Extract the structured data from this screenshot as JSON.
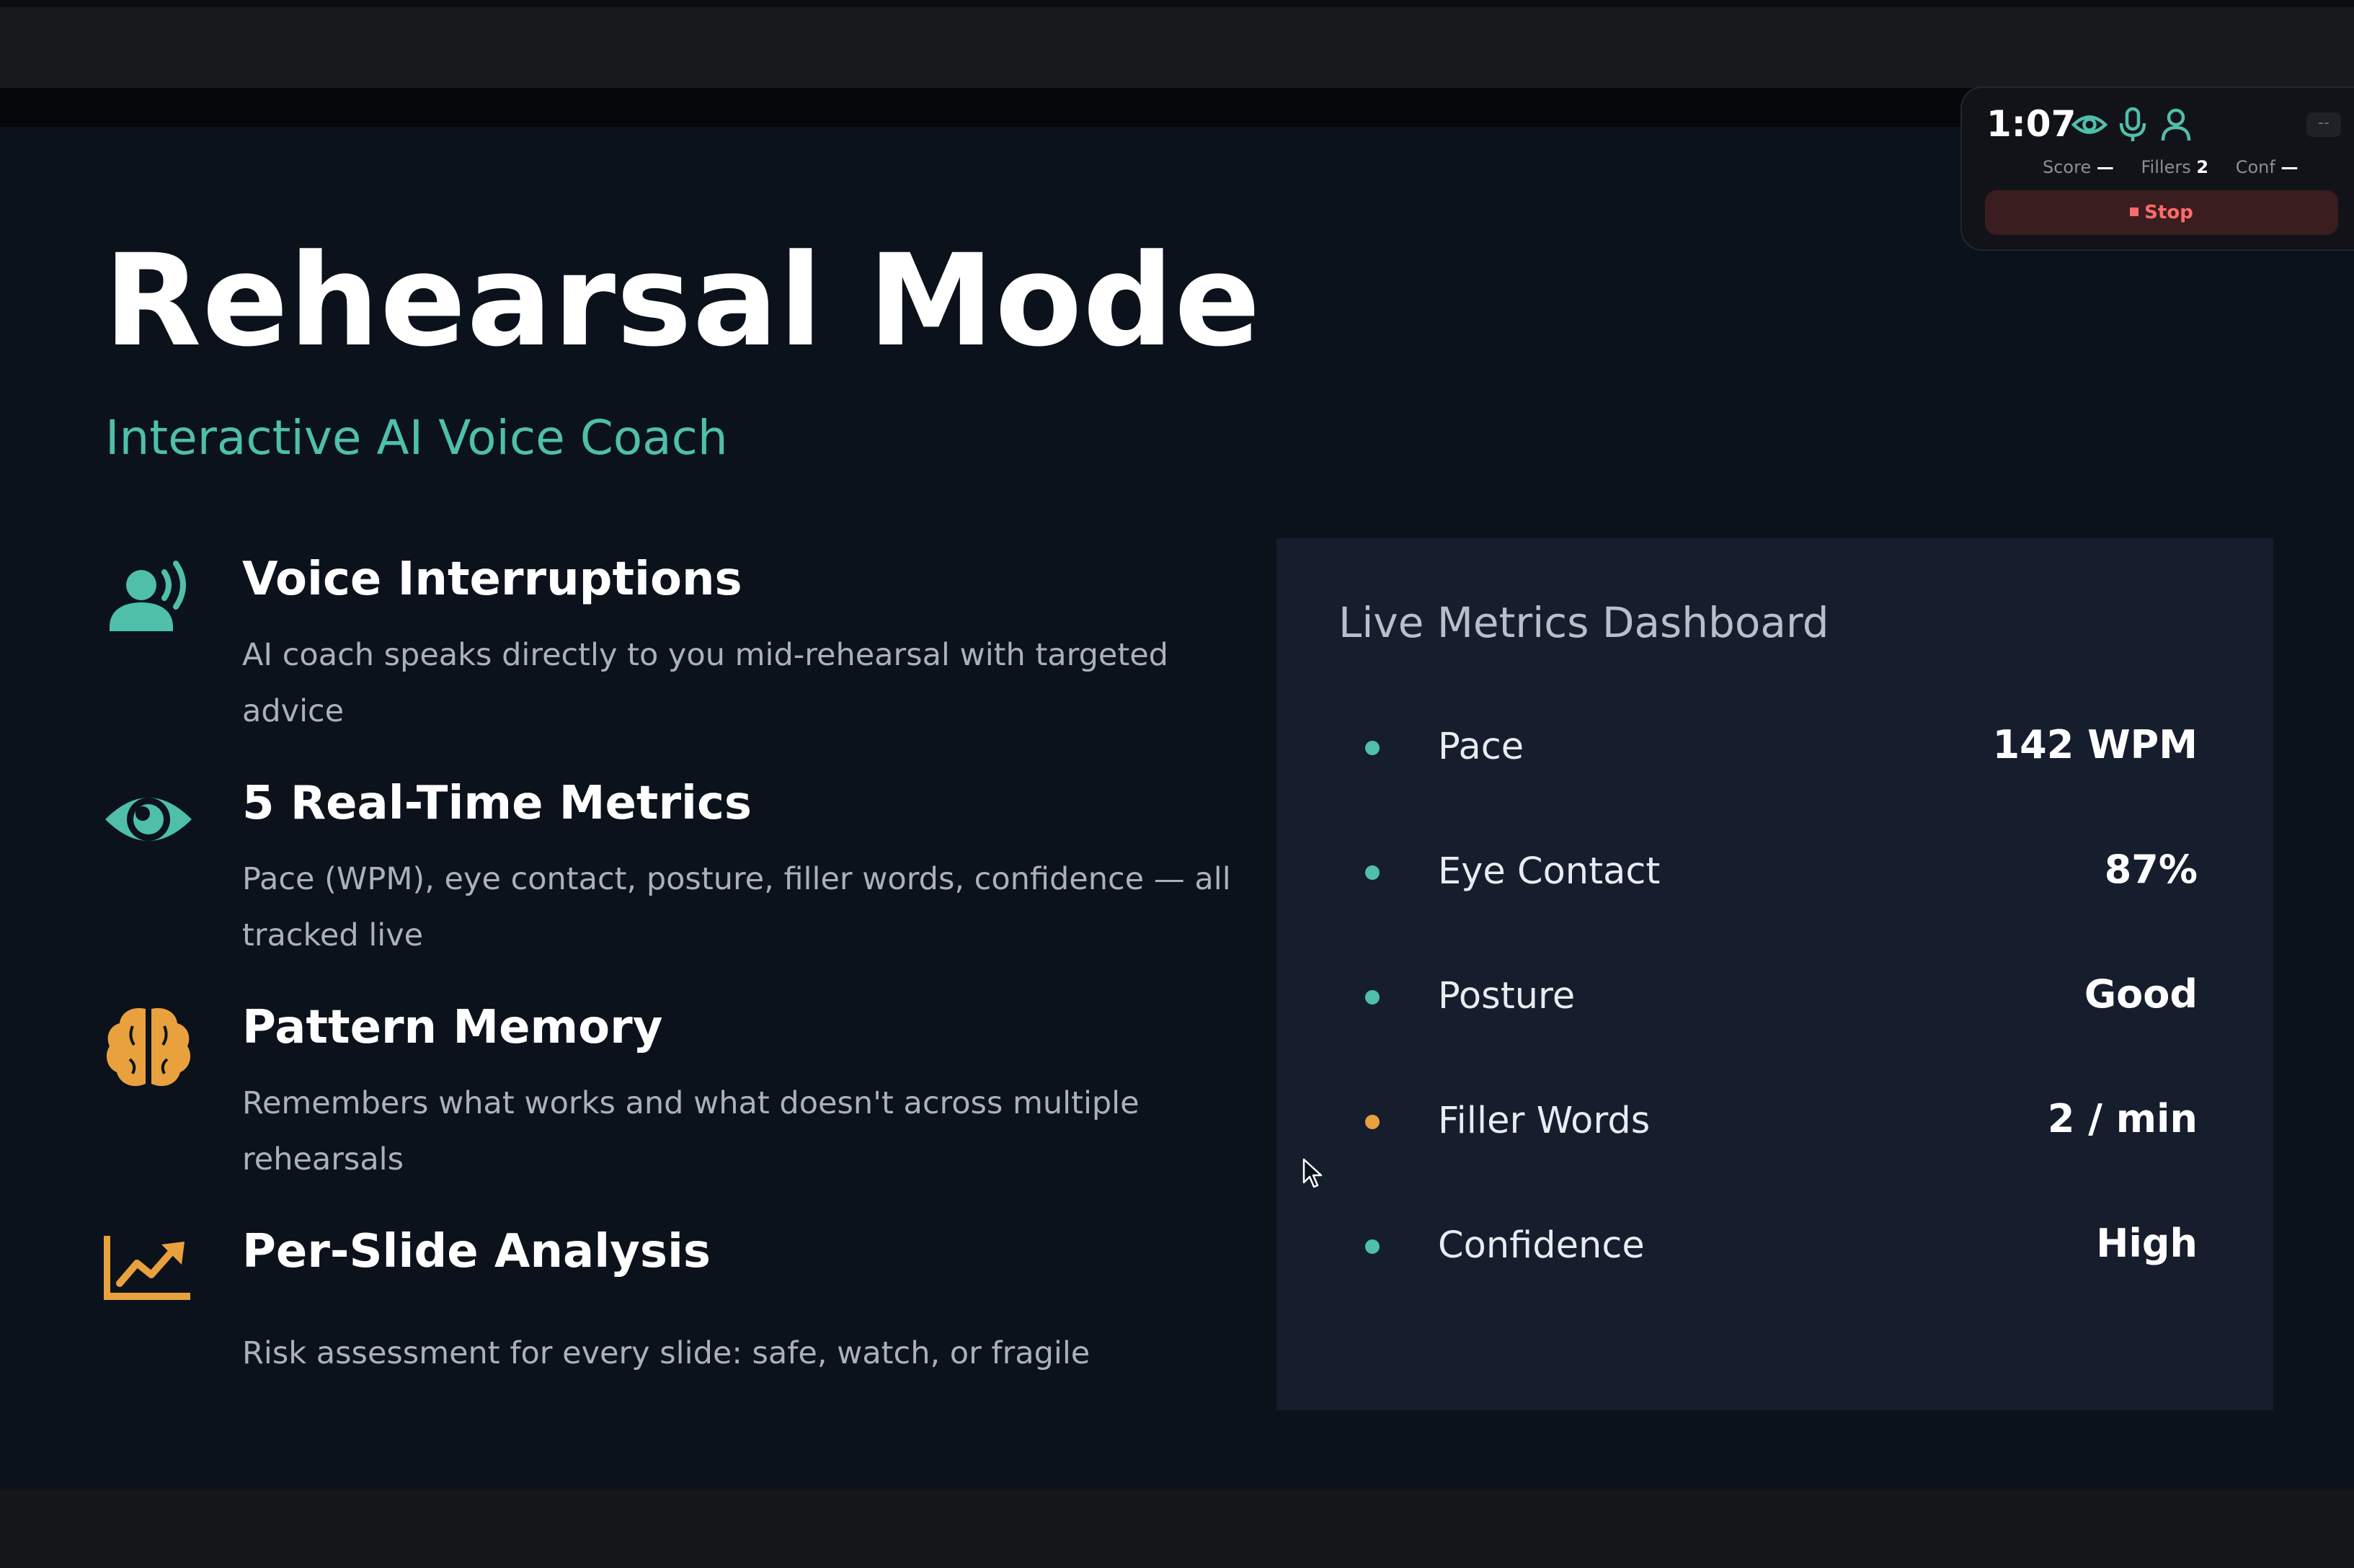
{
  "slide": {
    "title": "Rehearsal Mode",
    "subtitle": "Interactive AI Voice Coach",
    "features": [
      {
        "icon": "voice-speaking-icon",
        "title": "Voice Interruptions",
        "description": "AI coach speaks directly to you mid-rehearsal with targeted advice"
      },
      {
        "icon": "eye-icon",
        "title": "5 Real-Time Metrics",
        "description": "Pace (WPM), eye contact, posture, filler words, confidence — all tracked live"
      },
      {
        "icon": "brain-icon",
        "title": "Pattern Memory",
        "description": "Remembers what works and what doesn't across multiple rehearsals"
      },
      {
        "icon": "chart-line-icon",
        "title": "Per-Slide Analysis",
        "description": "Risk assessment for every slide: safe, watch, or fragile"
      }
    ],
    "dashboard": {
      "title": "Live Metrics Dashboard",
      "metrics": [
        {
          "label": "Pace",
          "value": "142 WPM",
          "status": "good"
        },
        {
          "label": "Eye Contact",
          "value": "87%",
          "status": "good"
        },
        {
          "label": "Posture",
          "value": "Good",
          "status": "good"
        },
        {
          "label": "Filler Words",
          "value": "2 / min",
          "status": "warning"
        },
        {
          "label": "Confidence",
          "value": "High",
          "status": "good"
        }
      ]
    }
  },
  "widget": {
    "timer": "1:07",
    "icons": [
      "eye-icon",
      "microphone-icon",
      "person-icon"
    ],
    "collapse_label": "--",
    "stats": [
      {
        "label": "Score",
        "value": "—"
      },
      {
        "label": "Fillers",
        "value": "2"
      },
      {
        "label": "Conf",
        "value": "—"
      }
    ],
    "stop_label": "Stop"
  },
  "colors": {
    "accent_teal": "#4fbfa9",
    "accent_orange": "#e9a13d",
    "stop_red": "#ff6b6b",
    "slide_background": "#0b121c",
    "panel_background": "#161d2c"
  }
}
